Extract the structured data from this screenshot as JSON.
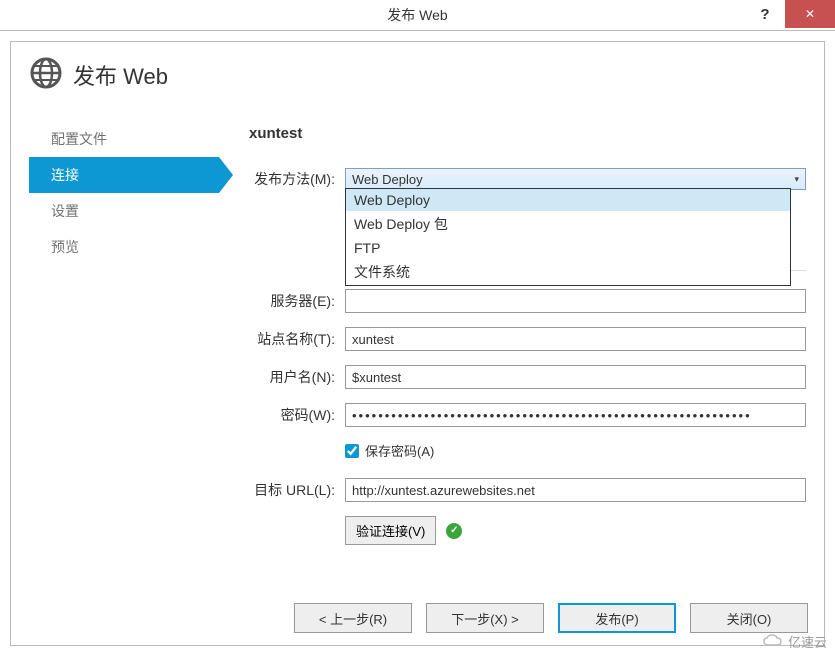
{
  "titlebar": {
    "title": "发布 Web"
  },
  "header": {
    "title": "发布 Web"
  },
  "nav": {
    "items": [
      {
        "label": "配置文件"
      },
      {
        "label": "连接"
      },
      {
        "label": "设置"
      },
      {
        "label": "预览"
      }
    ]
  },
  "form": {
    "profile_name": "xuntest",
    "publish_method_label": "发布方法(M):",
    "publish_method_value": "Web Deploy",
    "dropdown_options": [
      "Web Deploy",
      "Web Deploy 包",
      "FTP",
      "文件系统"
    ],
    "server_label": "服务器(E):",
    "server_value": "",
    "site_label": "站点名称(T):",
    "site_value": "xuntest",
    "user_label": "用户名(N):",
    "user_value": "$xuntest",
    "password_label": "密码(W):",
    "password_value": "•••••••••••••••••••••••••••••••••••••••••••••••••••••••••••••",
    "save_pw_label": "保存密码(A)",
    "dest_label": "目标 URL(L):",
    "dest_value": "http://xuntest.azurewebsites.net",
    "validate_label": "验证连接(V)"
  },
  "buttons": {
    "prev": "< 上一步(R)",
    "next": "下一步(X) >",
    "publish": "发布(P)",
    "close": "关闭(O)"
  },
  "watermark": "亿速云"
}
